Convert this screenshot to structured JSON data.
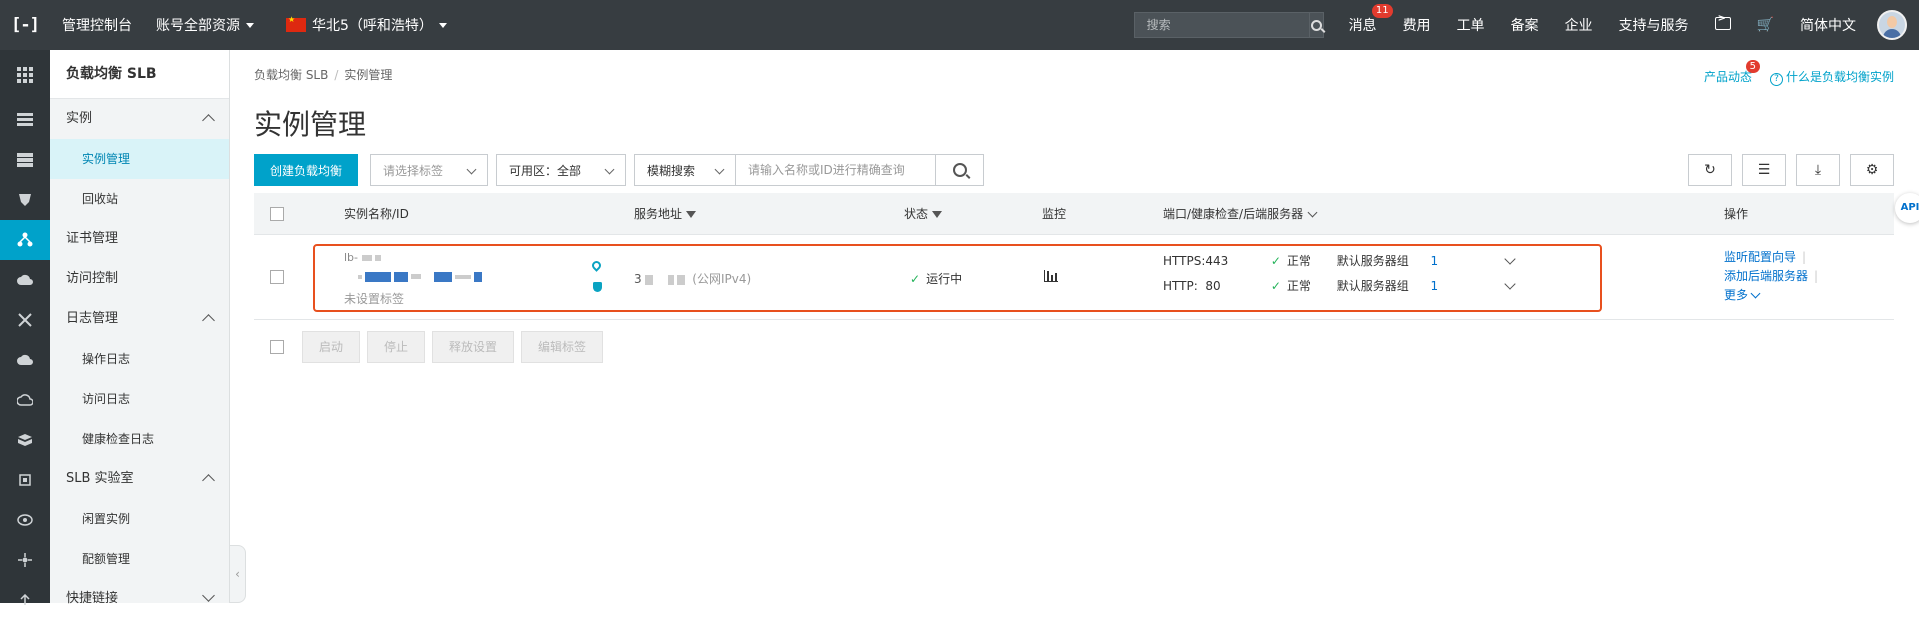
{
  "topbar": {
    "logo": "[-]",
    "console": "管理控制台",
    "account": "账号全部资源",
    "region": "华北5（呼和浩特）",
    "search_placeholder": "搜索",
    "messages": "消息",
    "messages_badge": "11",
    "fees": "费用",
    "tickets": "工单",
    "icp": "备案",
    "enterprise": "企业",
    "support": "支持与服务",
    "language": "简体中文"
  },
  "sidebar": {
    "title": "负载均衡 SLB",
    "group_instance": "实例",
    "item_instance_mgmt": "实例管理",
    "item_recycle": "回收站",
    "item_cert": "证书管理",
    "item_access": "访问控制",
    "group_log": "日志管理",
    "item_oplog": "操作日志",
    "item_accesslog": "访问日志",
    "item_healthlog": "健康检查日志",
    "group_lab": "SLB 实验室",
    "item_idle": "闲置实例",
    "item_quota": "配额管理",
    "group_links": "快捷链接"
  },
  "breadcrumb": {
    "root": "负载均衡 SLB",
    "current": "实例管理"
  },
  "header": {
    "product_news": "产品动态",
    "product_news_badge": "5",
    "what_is": "什么是负载均衡实例",
    "title": "实例管理"
  },
  "toolbar": {
    "create": "创建负载均衡",
    "tag_placeholder": "请选择标签",
    "zone_label": "可用区：全部",
    "fuzzy": "模糊搜索",
    "query_placeholder": "请输入名称或ID进行精确查询"
  },
  "table": {
    "col_name": "实例名称/ID",
    "col_addr": "服务地址",
    "col_status": "状态",
    "col_monitor": "监控",
    "col_port": "端口/健康检查/后端服务器",
    "col_ops": "操作",
    "row": {
      "name_partial": "lb-",
      "tag": "未设置标签",
      "addr_partial": "3",
      "addr_type": "(公网IPv4)",
      "status": "运行中",
      "listeners": [
        {
          "port": "HTTPS:443",
          "health": "正常",
          "group": "默认服务器组",
          "count": "1"
        },
        {
          "port": "HTTP:  80",
          "health": "正常",
          "group": "默认服务器组",
          "count": "1"
        }
      ],
      "op_listener": "监听配置向导",
      "op_backend": "添加后端服务器",
      "op_more": "更多"
    }
  },
  "bulk": {
    "start": "启动",
    "stop": "停止",
    "release": "释放设置",
    "edit_tags": "编辑标签"
  },
  "api_button": "API"
}
